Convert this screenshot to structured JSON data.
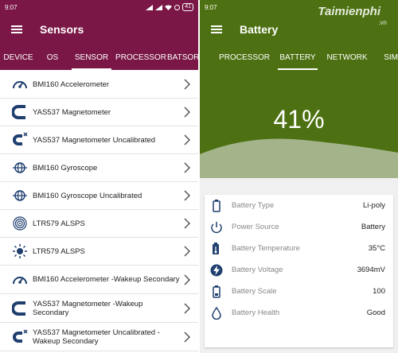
{
  "left": {
    "status": {
      "time": "9:07",
      "battery": "41"
    },
    "title": "Sensors",
    "tabs": [
      {
        "label": "DEVICE",
        "active": false
      },
      {
        "label": "OS",
        "active": false
      },
      {
        "label": "SENSOR",
        "active": true
      },
      {
        "label": "PROCESSOR",
        "active": false
      },
      {
        "label": "BATSOR",
        "active": false
      }
    ],
    "items": [
      {
        "label": "BMI160 Accelerometer",
        "icon": "speedometer-icon"
      },
      {
        "label": "YAS537 Magnetometer",
        "icon": "magnet-icon"
      },
      {
        "label": "YAS537 Magnetometer Uncalibrated",
        "icon": "magnet-uncalibrated-icon"
      },
      {
        "label": "BMI160 Gyroscope",
        "icon": "gyroscope-icon"
      },
      {
        "label": "BMI160 Gyroscope Uncalibrated",
        "icon": "gyroscope-icon"
      },
      {
        "label": "LTR579 ALSPS",
        "icon": "proximity-icon"
      },
      {
        "label": "LTR579 ALSPS",
        "icon": "light-icon"
      },
      {
        "label": "BMI160 Accelerometer -Wakeup Secondary",
        "icon": "speedometer-icon"
      },
      {
        "label": "YAS537 Magnetometer -Wakeup Secondary",
        "icon": "magnet-icon"
      },
      {
        "label": "YAS537 Magnetometer Uncalibrated - Wakeup Secondary",
        "icon": "magnet-uncalibrated-icon"
      }
    ]
  },
  "right": {
    "status": {
      "time": "9:07"
    },
    "title": "Battery",
    "watermark": "Taimienphi",
    "watermark_sub": ".vn",
    "tabs": [
      {
        "label": "PROCESSOR",
        "active": false
      },
      {
        "label": "BATTERY",
        "active": true
      },
      {
        "label": "NETWORK",
        "active": false
      },
      {
        "label": "SIM",
        "active": false
      }
    ],
    "level_text": "41%",
    "level_fraction": 0.41,
    "rows": [
      {
        "label": "Battery Type",
        "value": "Li-poly",
        "icon": "battery-icon"
      },
      {
        "label": "Power Source",
        "value": "Battery",
        "icon": "power-icon"
      },
      {
        "label": "Battery Temperature",
        "value": "35°C",
        "icon": "thermometer-icon"
      },
      {
        "label": "Battery Voltage",
        "value": "3694mV",
        "icon": "lightning-icon"
      },
      {
        "label": "Battery Scale",
        "value": "100",
        "icon": "battery-scale-icon"
      },
      {
        "label": "Battery Health",
        "value": "Good",
        "icon": "droplet-icon"
      }
    ]
  },
  "colors": {
    "left_accent": "#7a1746",
    "right_accent": "#4d7112"
  }
}
